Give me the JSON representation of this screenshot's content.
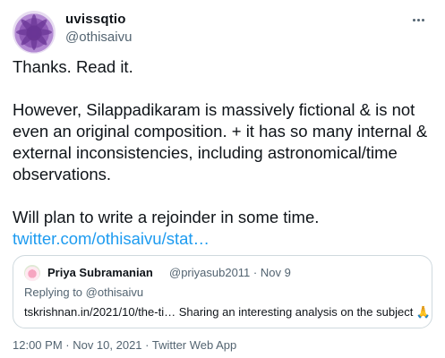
{
  "author": {
    "display_name": "uvissqtio",
    "handle": "@othisaivu"
  },
  "tweet": {
    "line1": "Thanks. Read it.",
    "para2": "However, Silappadikaram is massively fictional & is not even an original composition. + it has so many internal & external inconsistencies, including astronomical/time observations.",
    "para3_text": "Will plan to write a rejoinder in some time.",
    "para3_link": "twitter.com/othisaivu/stat…"
  },
  "quote": {
    "name": "Priya Subramanian",
    "handle": "@priyasub2011 · Nov 9",
    "replying": "Replying to @othisaivu",
    "text": "tskrishnan.in/2021/10/the-ti… Sharing an interesting  analysis on the subject 🙏"
  },
  "meta": {
    "timestamp": "12:00 PM · Nov 10, 2021 · Twitter Web App"
  },
  "icons": {
    "more": "more-options-icon",
    "avatar": "flower-avatar",
    "quote_avatar": "flower-avatar-small"
  },
  "colors": {
    "link": "#1d9bf0",
    "secondary": "#536471",
    "border": "#cfd9de"
  }
}
